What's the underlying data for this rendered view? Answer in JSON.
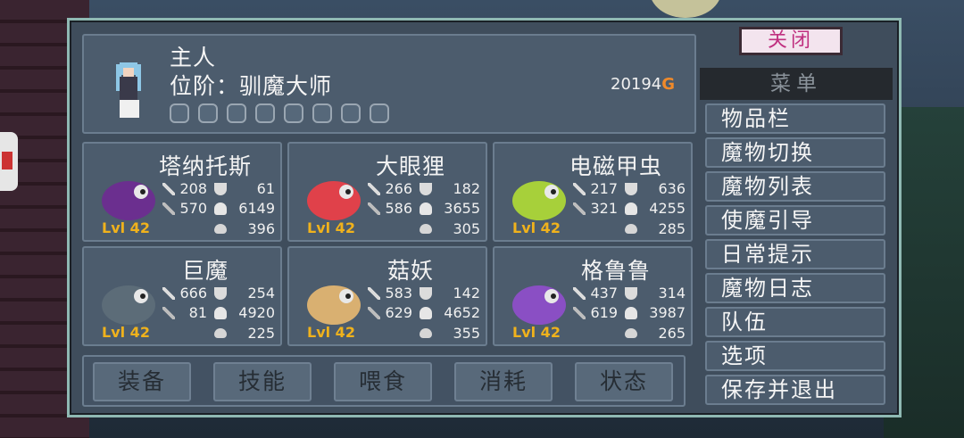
{
  "header": {
    "name": "主人",
    "rank": "位阶：驯魔大师",
    "gold_amount": "20194",
    "gold_symbol": "G",
    "rank_icons": [
      "claw-icon",
      "egg-icon",
      "skull-icon",
      "feather-icon",
      "feather-icon",
      "feather-icon",
      "keyhole-icon",
      "scroll-icon"
    ]
  },
  "monsters": [
    {
      "name": "塔纳托斯",
      "level": "Lvl 42",
      "atk": "208",
      "def": "61",
      "mag": "570",
      "hp": "6149",
      "mana": "396",
      "color": "#6b2f8f"
    },
    {
      "name": "大眼狸",
      "level": "Lvl 42",
      "atk": "266",
      "def": "182",
      "mag": "586",
      "hp": "3655",
      "mana": "305",
      "color": "#e0414a"
    },
    {
      "name": "电磁甲虫",
      "level": "Lvl 42",
      "atk": "217",
      "def": "636",
      "mag": "321",
      "hp": "4255",
      "mana": "285",
      "color": "#a7d03a"
    },
    {
      "name": "巨魔",
      "level": "Lvl 42",
      "atk": "666",
      "def": "254",
      "mag": "81",
      "hp": "4920",
      "mana": "225",
      "color": "#5c6c78"
    },
    {
      "name": "菇妖",
      "level": "Lvl 42",
      "atk": "583",
      "def": "142",
      "mag": "629",
      "hp": "4652",
      "mana": "355",
      "color": "#d9b071"
    },
    {
      "name": "格鲁鲁",
      "level": "Lvl 42",
      "atk": "437",
      "def": "314",
      "mag": "619",
      "hp": "3987",
      "mana": "265",
      "color": "#8a4fc4"
    }
  ],
  "tabs": [
    "装备",
    "技能",
    "喂食",
    "消耗",
    "状态"
  ],
  "menu": {
    "close": "关闭",
    "title": "菜单",
    "items": [
      "物品栏",
      "魔物切换",
      "魔物列表",
      "使魔引导",
      "日常提示",
      "魔物日志",
      "队伍",
      "选项",
      "保存并退出"
    ]
  }
}
